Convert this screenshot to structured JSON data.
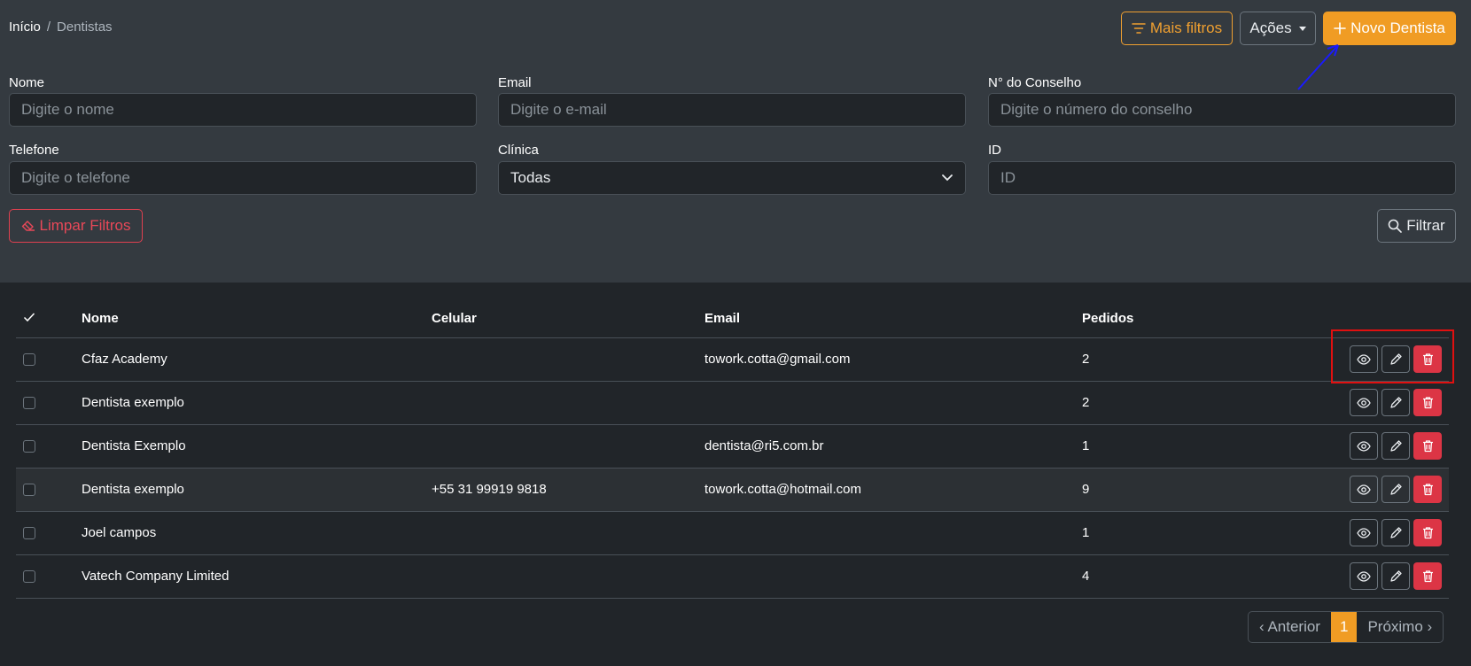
{
  "breadcrumb": {
    "home": "Início",
    "separator": "/",
    "current": "Dentistas"
  },
  "toolbar": {
    "more_filters": "Mais filtros",
    "actions": "Ações",
    "new_dentist": "Novo Dentista"
  },
  "filters": {
    "name": {
      "label": "Nome",
      "placeholder": "Digite o nome"
    },
    "email": {
      "label": "Email",
      "placeholder": "Digite o e-mail"
    },
    "council": {
      "label": "N° do Conselho",
      "placeholder": "Digite o número do conselho"
    },
    "phone": {
      "label": "Telefone",
      "placeholder": "Digite o telefone"
    },
    "clinic": {
      "label": "Clínica",
      "value": "Todas"
    },
    "id": {
      "label": "ID",
      "placeholder": "ID"
    },
    "clear": "Limpar Filtros",
    "filter": "Filtrar"
  },
  "table": {
    "headers": {
      "name": "Nome",
      "phone": "Celular",
      "email": "Email",
      "orders": "Pedidos"
    },
    "rows": [
      {
        "name": "Cfaz Academy",
        "phone": "",
        "email": "towork.cotta@gmail.com",
        "orders": "2"
      },
      {
        "name": "Dentista exemplo",
        "phone": "",
        "email": "",
        "orders": "2"
      },
      {
        "name": "Dentista Exemplo",
        "phone": "",
        "email": "dentista@ri5.com.br",
        "orders": "1"
      },
      {
        "name": "Dentista exemplo",
        "phone": "+55 31 99919 9818",
        "email": "towork.cotta@hotmail.com",
        "orders": "9"
      },
      {
        "name": "Joel campos",
        "phone": "",
        "email": "",
        "orders": "1"
      },
      {
        "name": "Vatech Company Limited",
        "phone": "",
        "email": "",
        "orders": "4"
      }
    ]
  },
  "pagination": {
    "prev": "‹ Anterior",
    "current": "1",
    "next": "Próximo ›"
  },
  "colors": {
    "accent": "#f09c24",
    "danger": "#dc3545",
    "annotation_box": "#e01010",
    "annotation_arrow": "#1a1aff"
  },
  "icons": [
    "filter-icon",
    "plus-icon",
    "eraser-icon",
    "search-icon",
    "check-icon",
    "eye-icon",
    "pencil-icon",
    "trash-icon",
    "chevron-down-icon"
  ]
}
